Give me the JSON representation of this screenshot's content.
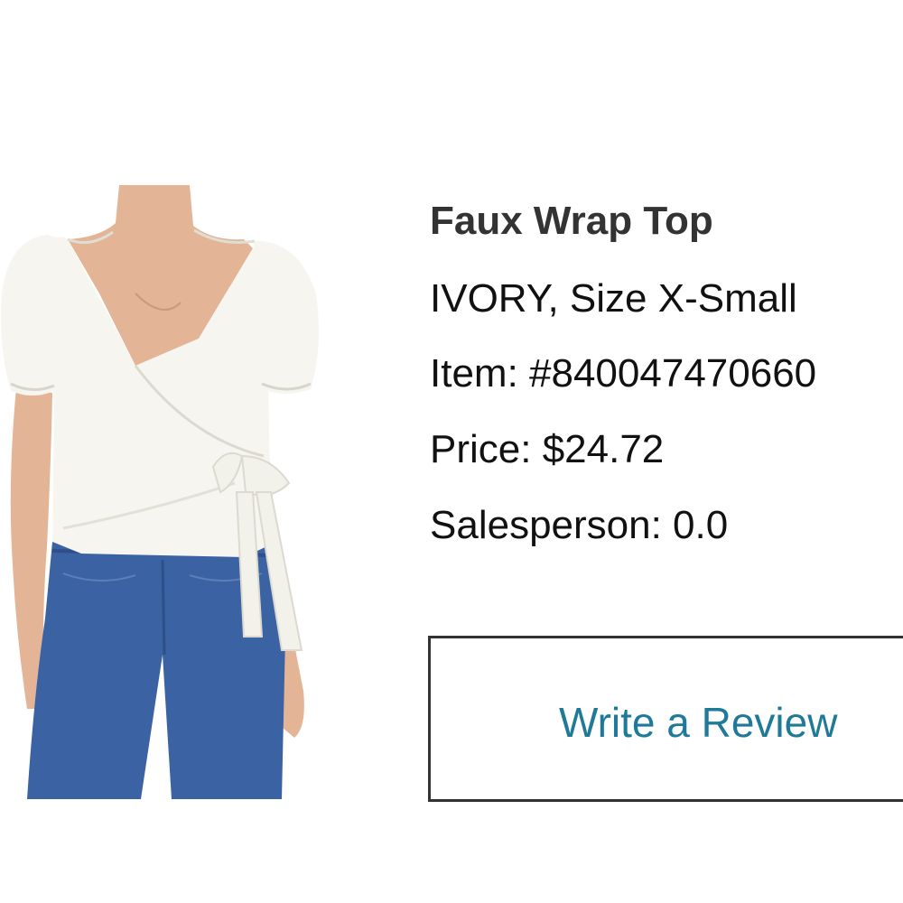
{
  "product": {
    "name": "Faux Wrap Top",
    "color_size": "IVORY, Size X-Small",
    "item_number": "Item: #840047470660",
    "price": "Price: $24.72",
    "salesperson": "Salesperson: 0.0"
  },
  "actions": {
    "write_review_label": "Write a Review"
  },
  "colors": {
    "review_link": "#1f7a9a",
    "title": "#333333",
    "text": "#111111",
    "button_border": "#333333"
  }
}
